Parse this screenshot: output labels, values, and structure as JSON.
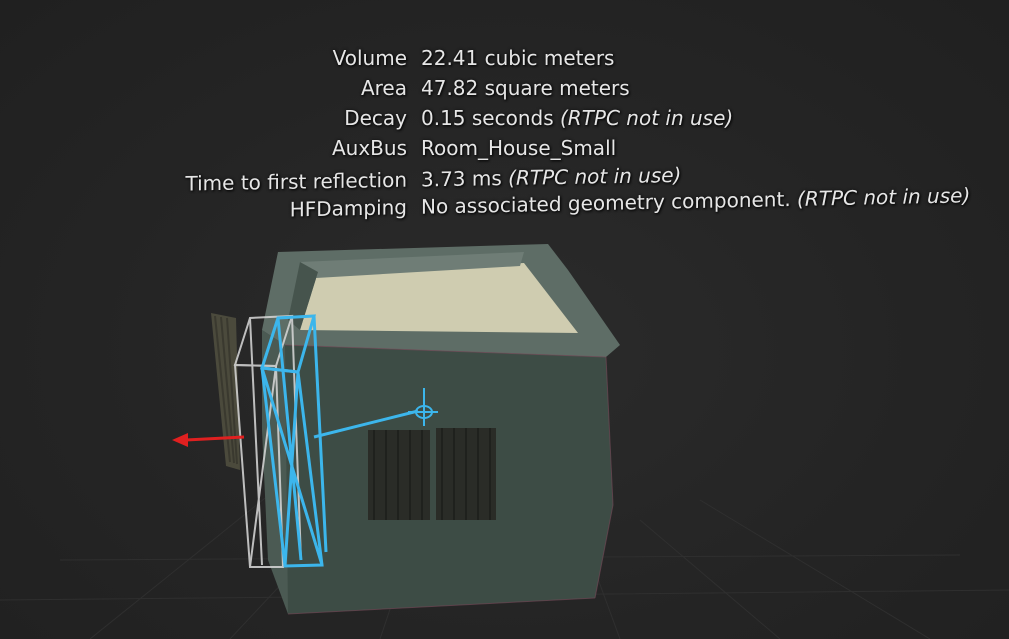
{
  "properties": [
    {
      "label": "Volume",
      "value": "22.41 cubic meters",
      "note": ""
    },
    {
      "label": "Area",
      "value": "47.82 square meters",
      "note": ""
    },
    {
      "label": "Decay",
      "value": "0.15 seconds",
      "note": "(RTPC not in use)"
    },
    {
      "label": "AuxBus",
      "value": "Room_House_Small",
      "note": ""
    },
    {
      "label": "Time to first reflection",
      "value": "3.73 ms",
      "note": "(RTPC not in use)"
    },
    {
      "label": "HFDamping",
      "value": "No associated geometry component.",
      "note": "(RTPC not in use)"
    }
  ],
  "colors": {
    "background": "#262626",
    "room_wall": "#3c4a44",
    "room_top": "#5d6b64",
    "room_floor": "#cfccb0",
    "selection_outline": "#d8d8d8",
    "portal_highlight": "#3ab4ea",
    "x_axis_arrow": "#e02020"
  },
  "icons": {
    "gizmo": "transform-pivot-icon",
    "arrow": "x-axis-arrow-icon"
  }
}
